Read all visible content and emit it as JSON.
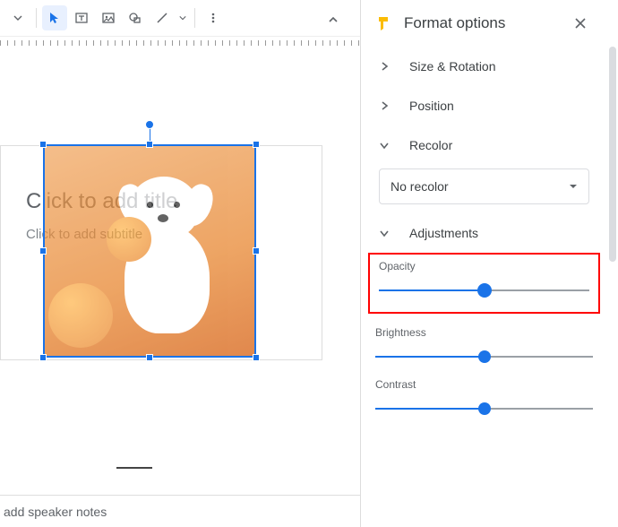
{
  "toolbar": {
    "tools": [
      "select",
      "textbox",
      "image",
      "shape",
      "line"
    ]
  },
  "canvas": {
    "title_placeholder": "Click to add title",
    "subtitle_placeholder": "Click to add subtitle",
    "notes_placeholder": "add speaker notes"
  },
  "panel": {
    "title": "Format options",
    "sections": {
      "size_rotation": "Size & Rotation",
      "position": "Position",
      "recolor": "Recolor",
      "adjustments": "Adjustments"
    },
    "recolor_value": "No recolor",
    "adjustments": {
      "opacity": {
        "label": "Opacity",
        "value": 50
      },
      "brightness": {
        "label": "Brightness",
        "value": 50
      },
      "contrast": {
        "label": "Contrast",
        "value": 50
      }
    }
  }
}
